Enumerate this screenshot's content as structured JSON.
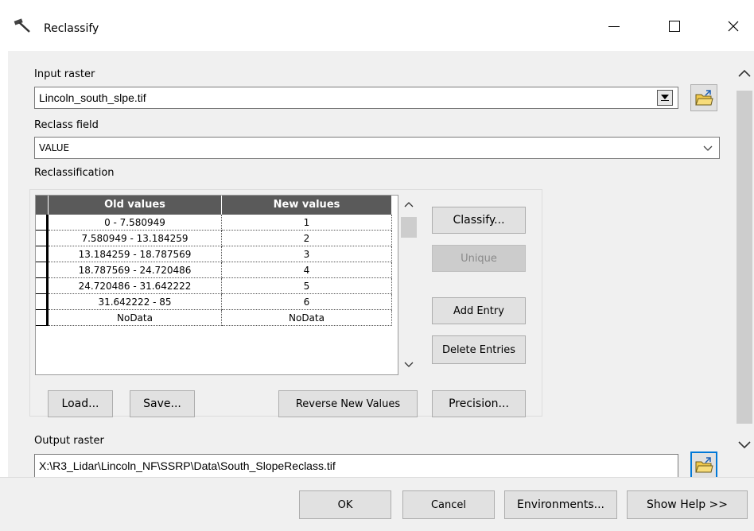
{
  "window": {
    "title": "Reclassify"
  },
  "input_raster": {
    "label": "Input raster",
    "value": "Lincoln_south_slpe.tif"
  },
  "reclass_field": {
    "label": "Reclass field",
    "value": "VALUE"
  },
  "reclassification": {
    "label": "Reclassification",
    "columns": [
      "Old values",
      "New values"
    ],
    "rows": [
      {
        "old": "0 - 7.580949",
        "new": "1"
      },
      {
        "old": "7.580949 - 13.184259",
        "new": "2"
      },
      {
        "old": "13.184259 - 18.787569",
        "new": "3"
      },
      {
        "old": "18.787569 - 24.720486",
        "new": "4"
      },
      {
        "old": "24.720486 - 31.642222",
        "new": "5"
      },
      {
        "old": "31.642222 - 85",
        "new": "6"
      },
      {
        "old": "NoData",
        "new": "NoData"
      }
    ],
    "buttons": {
      "classify": "Classify...",
      "unique": "Unique",
      "add_entry": "Add Entry",
      "delete_entries": "Delete Entries",
      "load": "Load...",
      "save": "Save...",
      "reverse": "Reverse New Values",
      "precision": "Precision..."
    }
  },
  "output_raster": {
    "label": "Output raster",
    "value": "X:\\R3_Lidar\\Lincoln_NF\\SSRP\\Data\\South_SlopeReclass.tif"
  },
  "footer": {
    "ok": "OK",
    "cancel": "Cancel",
    "environments": "Environments...",
    "show_help": "Show Help >>"
  }
}
